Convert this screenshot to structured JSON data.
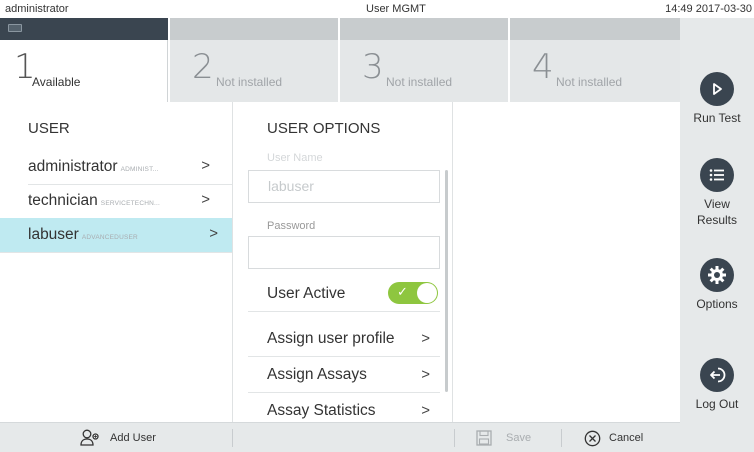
{
  "topbar": {
    "user": "administrator",
    "title": "User MGMT",
    "datetime": "14:49 2017-03-30"
  },
  "tabs": [
    {
      "number": "1",
      "label": "Available"
    },
    {
      "number": "2",
      "label": "Not installed"
    },
    {
      "number": "3",
      "label": "Not installed"
    },
    {
      "number": "4",
      "label": "Not installed"
    }
  ],
  "sidebar": {
    "run_test": "Run Test",
    "view_results": "View Results",
    "options": "Options",
    "log_out": "Log Out"
  },
  "userlist": {
    "heading": "USER",
    "users": [
      {
        "name": "administrator",
        "role": "ADMINIST..."
      },
      {
        "name": "technician",
        "role": "SERVICETECHN..."
      },
      {
        "name": "labuser",
        "role": "ADVANCEDUSER"
      }
    ]
  },
  "options": {
    "heading": "USER OPTIONS",
    "username_label": "User Name",
    "username_value": "labuser",
    "password_label": "Password",
    "password_value": "",
    "user_active_label": "User Active",
    "user_active": true,
    "assign_profile": "Assign user profile",
    "assign_assays": "Assign Assays",
    "assay_statistics": "Assay Statistics"
  },
  "bottombar": {
    "add_user": "Add User",
    "save": "Save",
    "cancel": "Cancel"
  },
  "colors": {
    "dark": "#3a4550",
    "selected_row": "#bfeaf1",
    "toggle_on": "#8ec63f",
    "sidebar_bg": "#e6e9ea"
  }
}
